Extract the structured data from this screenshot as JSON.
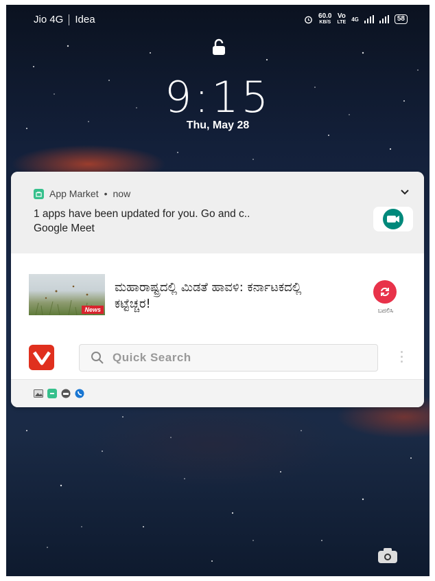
{
  "status_bar": {
    "carrier_1": "Jio 4G",
    "carrier_2": "Idea",
    "speed_value": "60.0",
    "speed_unit": "KB/S",
    "volte_top": "Vo",
    "volte_bottom": "LTE",
    "network": "4G",
    "battery": "58"
  },
  "lockscreen": {
    "time": "9:15",
    "date": "Thu, May 28"
  },
  "notification": {
    "app_name": "App Market",
    "separator": "•",
    "time": "now",
    "text_line1": "1 apps have been updated for you. Go and c..",
    "text_line2": "Google Meet",
    "icon": "google-meet-icon"
  },
  "news_card": {
    "thumb_badge": "News",
    "headline": "ಮಹಾರಾಷ್ಟ್ರದಲ್ಲಿ ಮಿಡತೆ ಹಾವಳಿ: ಕರ್ನಾಟಕದಲ್ಲಿ ಕಟ್ಟೆಚ್ಚರ!",
    "refresh_label": "ಬದಲಿಸಿ"
  },
  "search": {
    "placeholder": "Quick Search"
  },
  "colors": {
    "accent_red": "#e0301e",
    "refresh_red": "#e8324a",
    "meet_green": "#00897b",
    "app_market_green": "#36c08c"
  }
}
